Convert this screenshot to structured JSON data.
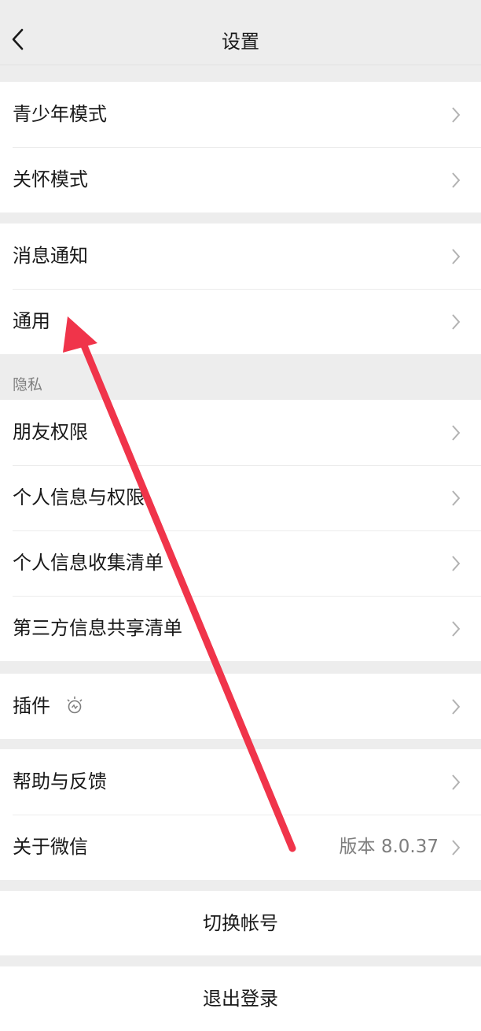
{
  "nav": {
    "title": "设置",
    "back_icon": "chevron-left-icon"
  },
  "groups": {
    "g1": {
      "items": [
        {
          "label": "青少年模式"
        },
        {
          "label": "关怀模式"
        }
      ]
    },
    "g2": {
      "items": [
        {
          "label": "消息通知"
        },
        {
          "label": "通用"
        }
      ]
    },
    "privacy": {
      "header": "隐私",
      "items": [
        {
          "label": "朋友权限"
        },
        {
          "label": "个人信息与权限"
        },
        {
          "label": "个人信息收集清单"
        },
        {
          "label": "第三方信息共享清单"
        }
      ]
    },
    "g4": {
      "items": [
        {
          "label": "插件",
          "icon": "plugin-bulb-icon"
        }
      ]
    },
    "g5": {
      "items": [
        {
          "label": "帮助与反馈"
        },
        {
          "label": "关于微信",
          "value": "版本 8.0.37"
        }
      ]
    }
  },
  "buttons": {
    "switch_account": "切换帐号",
    "logout": "退出登录"
  },
  "colors": {
    "background": "#ededed",
    "row": "#ffffff",
    "text": "#191919",
    "secondary_text": "#7f7f7f",
    "chevron": "#b2b2b2",
    "annotation_arrow": "#f0344a"
  }
}
